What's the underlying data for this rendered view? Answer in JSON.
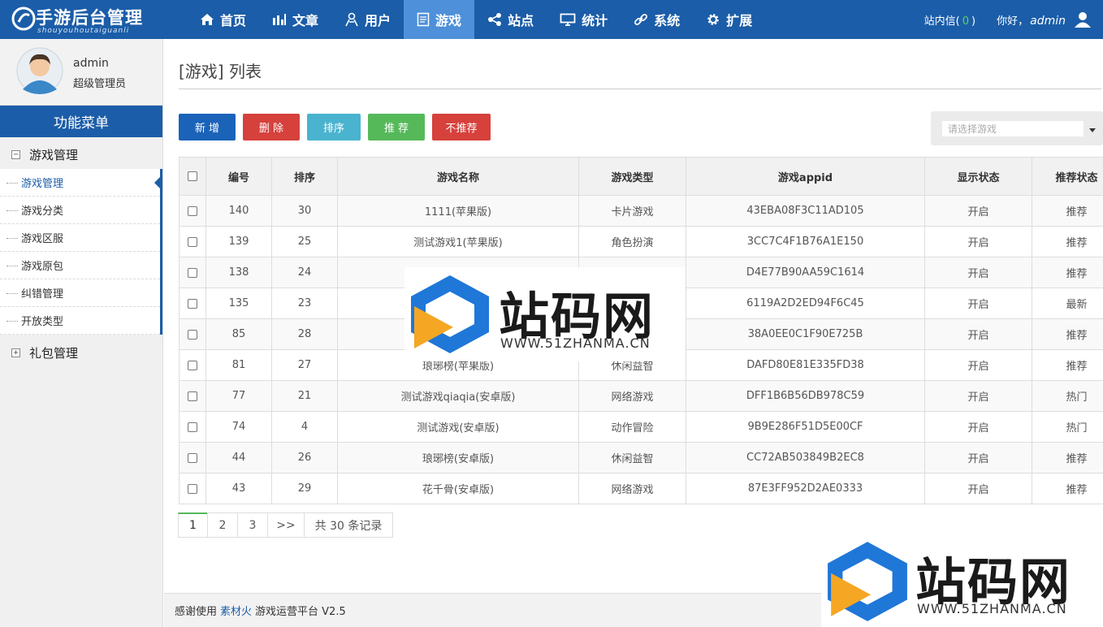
{
  "brand": {
    "title": "手游后台管理",
    "subtitle": "shouyouhoutaiguanli"
  },
  "nav": [
    {
      "label": "首页",
      "icon": "home-icon"
    },
    {
      "label": "文章",
      "icon": "bar-chart-icon"
    },
    {
      "label": "用户",
      "icon": "user-icon"
    },
    {
      "label": "游戏",
      "icon": "document-icon",
      "active": true
    },
    {
      "label": "站点",
      "icon": "share-icon"
    },
    {
      "label": "统计",
      "icon": "monitor-icon"
    },
    {
      "label": "系统",
      "icon": "link-icon"
    },
    {
      "label": "扩展",
      "icon": "gear-icon"
    }
  ],
  "topright": {
    "messages_label": "站内信",
    "messages_open": "(",
    "messages_count": "0",
    "messages_close": ")",
    "hello": "你好，",
    "username": "admin"
  },
  "profile": {
    "name": "admin",
    "role": "超级管理员"
  },
  "sidebar": {
    "menu_title": "功能菜单",
    "groups": [
      {
        "toggle": "−",
        "label": "游戏管理",
        "expanded": true
      },
      {
        "toggle": "+",
        "label": "礼包管理",
        "expanded": false
      }
    ],
    "items": [
      {
        "label": "游戏管理",
        "active": true
      },
      {
        "label": "游戏分类"
      },
      {
        "label": "游戏区服"
      },
      {
        "label": "游戏原包"
      },
      {
        "label": "纠错管理"
      },
      {
        "label": "开放类型"
      }
    ]
  },
  "main": {
    "title": "[游戏] 列表",
    "buttons": {
      "new": "新 增",
      "delete": "删 除",
      "sort": "排序",
      "recommend": "推 荐",
      "unrecommend": "不推荐"
    },
    "game_select": {
      "placeholder": "请选择游戏"
    }
  },
  "table": {
    "columns": [
      "编号",
      "排序",
      "游戏名称",
      "游戏类型",
      "游戏appid",
      "显示状态",
      "推荐状态"
    ],
    "rows": [
      [
        "140",
        "30",
        "1111(苹果版)",
        "卡片游戏",
        "43EBA08F3C11AD105",
        "开启",
        "推荐"
      ],
      [
        "139",
        "25",
        "测试游戏1(苹果版)",
        "角色扮演",
        "3CC7C4F1B76A1E150",
        "开启",
        "推荐"
      ],
      [
        "138",
        "24",
        "",
        "",
        "D4E77B90AA59C1614",
        "开启",
        "推荐"
      ],
      [
        "135",
        "23",
        "y",
        "",
        "6119A2D2ED94F6C45",
        "开启",
        "最新"
      ],
      [
        "85",
        "28",
        "",
        "",
        "38A0EE0C1F90E725B",
        "开启",
        "推荐"
      ],
      [
        "81",
        "27",
        "琅琊榜(苹果版)",
        "休闲益智",
        "DAFD80E81E335FD38",
        "开启",
        "推荐"
      ],
      [
        "77",
        "21",
        "测试游戏qiaqia(安卓版)",
        "网络游戏",
        "DFF1B6B56DB978C59",
        "开启",
        "热门"
      ],
      [
        "74",
        "4",
        "测试游戏(安卓版)",
        "动作冒险",
        "9B9E286F51D5E00CF",
        "开启",
        "热门"
      ],
      [
        "44",
        "26",
        "琅琊榜(安卓版)",
        "休闲益智",
        "CC72AB503849B2EC8",
        "开启",
        "推荐"
      ],
      [
        "43",
        "29",
        "花千骨(安卓版)",
        "网络游戏",
        "87E3FF952D2AE0333",
        "开启",
        "推荐"
      ]
    ]
  },
  "pagination": {
    "pages": [
      "1",
      "2",
      "3"
    ],
    "next": ">>",
    "total": "共 30 条记录",
    "current": "1"
  },
  "footer": {
    "prefix": "感谢使用",
    "link": "素材火",
    "suffix": "游戏运营平台 V2.5"
  },
  "watermark": {
    "text": "站码网",
    "url": "WWW.51ZHANMA.CN"
  },
  "colors": {
    "primary": "#1b5da8",
    "nav_active": "#4e90d9",
    "danger": "#d6413c",
    "info": "#4ab3cf",
    "success": "#55b95a"
  }
}
